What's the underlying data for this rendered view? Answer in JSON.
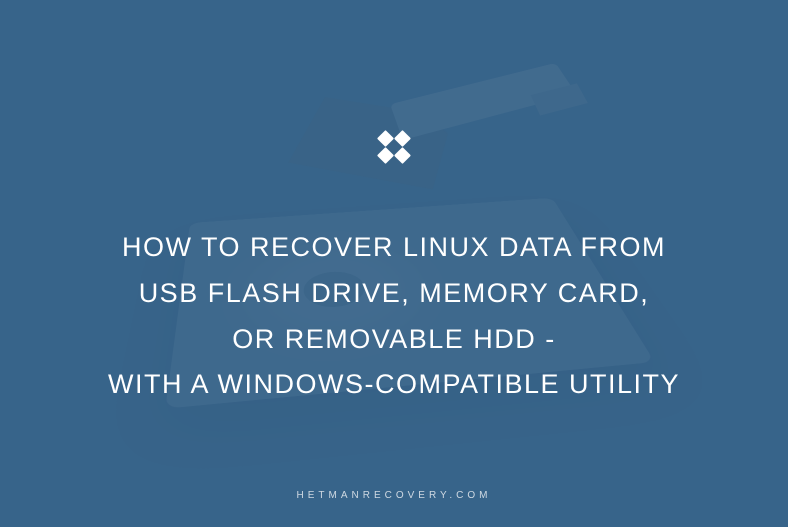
{
  "title": {
    "line1": "HOW TO RECOVER LINUX DATA FROM",
    "line2": "USB FLASH DRIVE, MEMORY CARD,",
    "line3": "OR REMOVABLE HDD -",
    "line4": "WITH A WINDOWS-COMPATIBLE UTILITY"
  },
  "footer": "HETMANRECOVERY.COM",
  "logo_name": "hetman-logo-icon"
}
